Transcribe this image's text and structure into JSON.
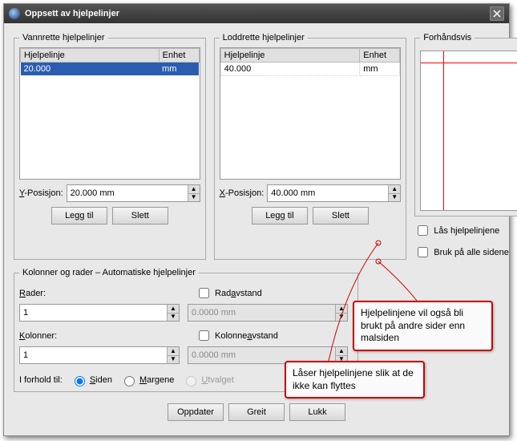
{
  "window": {
    "title": "Oppsett av hjelpelinjer"
  },
  "horizontal": {
    "legend": "Vannrette hjelpelinjer",
    "col_guide": "Hjelpelinje",
    "col_unit": "Enhet",
    "row_value": "20.000",
    "row_unit": "mm",
    "pos_label_pre": "Y",
    "pos_label_post": "-Posisjon:",
    "pos_value": "20.000 mm",
    "add": "Legg til",
    "del": "Slett"
  },
  "vertical": {
    "legend": "Loddrette hjelpelinjer",
    "col_guide": "Hjelpelinje",
    "col_unit": "Enhet",
    "row_value": "40.000",
    "row_unit": "mm",
    "pos_label_pre": "X",
    "pos_label_post": "-Posisjon:",
    "pos_value": "40.000 mm",
    "add": "Legg til",
    "del": "Slett"
  },
  "preview": {
    "legend": "Forhåndsvis"
  },
  "options": {
    "lock": "Lås hjelpelinjene",
    "apply_all": "Bruk på alle sidene"
  },
  "auto": {
    "legend": "Kolonner og rader – Automatiske hjelpelinjer",
    "rows_label_pre": "R",
    "rows_label_post": "ader:",
    "rows_value": "1",
    "row_gap_pre": "R",
    "row_gap_mid": "ad",
    "row_gap_u": "a",
    "row_gap_post": "vstand",
    "row_gap_value": "0.0000 mm",
    "cols_label_pre": "K",
    "cols_label_post": "olonner:",
    "cols_value": "1",
    "col_gap_pre": "Kolonne",
    "col_gap_u": "a",
    "col_gap_post": "vstand",
    "col_gap_value": "0.0000 mm",
    "refer_label": "I forhold til:",
    "refer_page": "Siden",
    "refer_margins": "Margene",
    "refer_selection": "Utvalget"
  },
  "buttons": {
    "update": "Oppdater",
    "ok": "Greit",
    "close": "Lukk"
  },
  "callouts": {
    "lock": "Låser hjelpelinjene slik at de ikke kan flyttes",
    "apply": "Hjelpelinjene vil også bli brukt på andre sider enn malsiden"
  }
}
